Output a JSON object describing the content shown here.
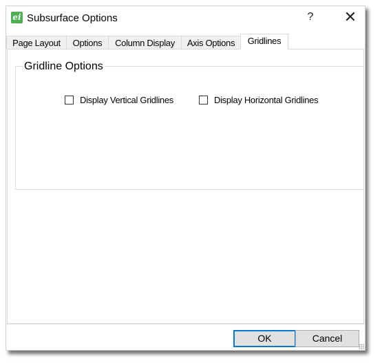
{
  "window": {
    "title": "Subsurface Options",
    "app_icon_glyph": "ei",
    "help_label": "?",
    "close_label": "✕"
  },
  "tabs": [
    {
      "label": "Page Layout",
      "active": false
    },
    {
      "label": "Options",
      "active": false
    },
    {
      "label": "Column Display",
      "active": false
    },
    {
      "label": "Axis Options",
      "active": false
    },
    {
      "label": "Gridlines",
      "active": true
    }
  ],
  "gridlines": {
    "group_title": "Gridline Options",
    "checkboxes": [
      {
        "label": "Display Vertical Gridlines",
        "checked": false
      },
      {
        "label": "Display Horizontal Gridlines",
        "checked": false
      }
    ]
  },
  "footer": {
    "ok_label": "OK",
    "cancel_label": "Cancel"
  },
  "colors": {
    "app_icon": "#4caf50",
    "default_button_border": "#0078d7",
    "button_bg": "#e1e1e1"
  }
}
